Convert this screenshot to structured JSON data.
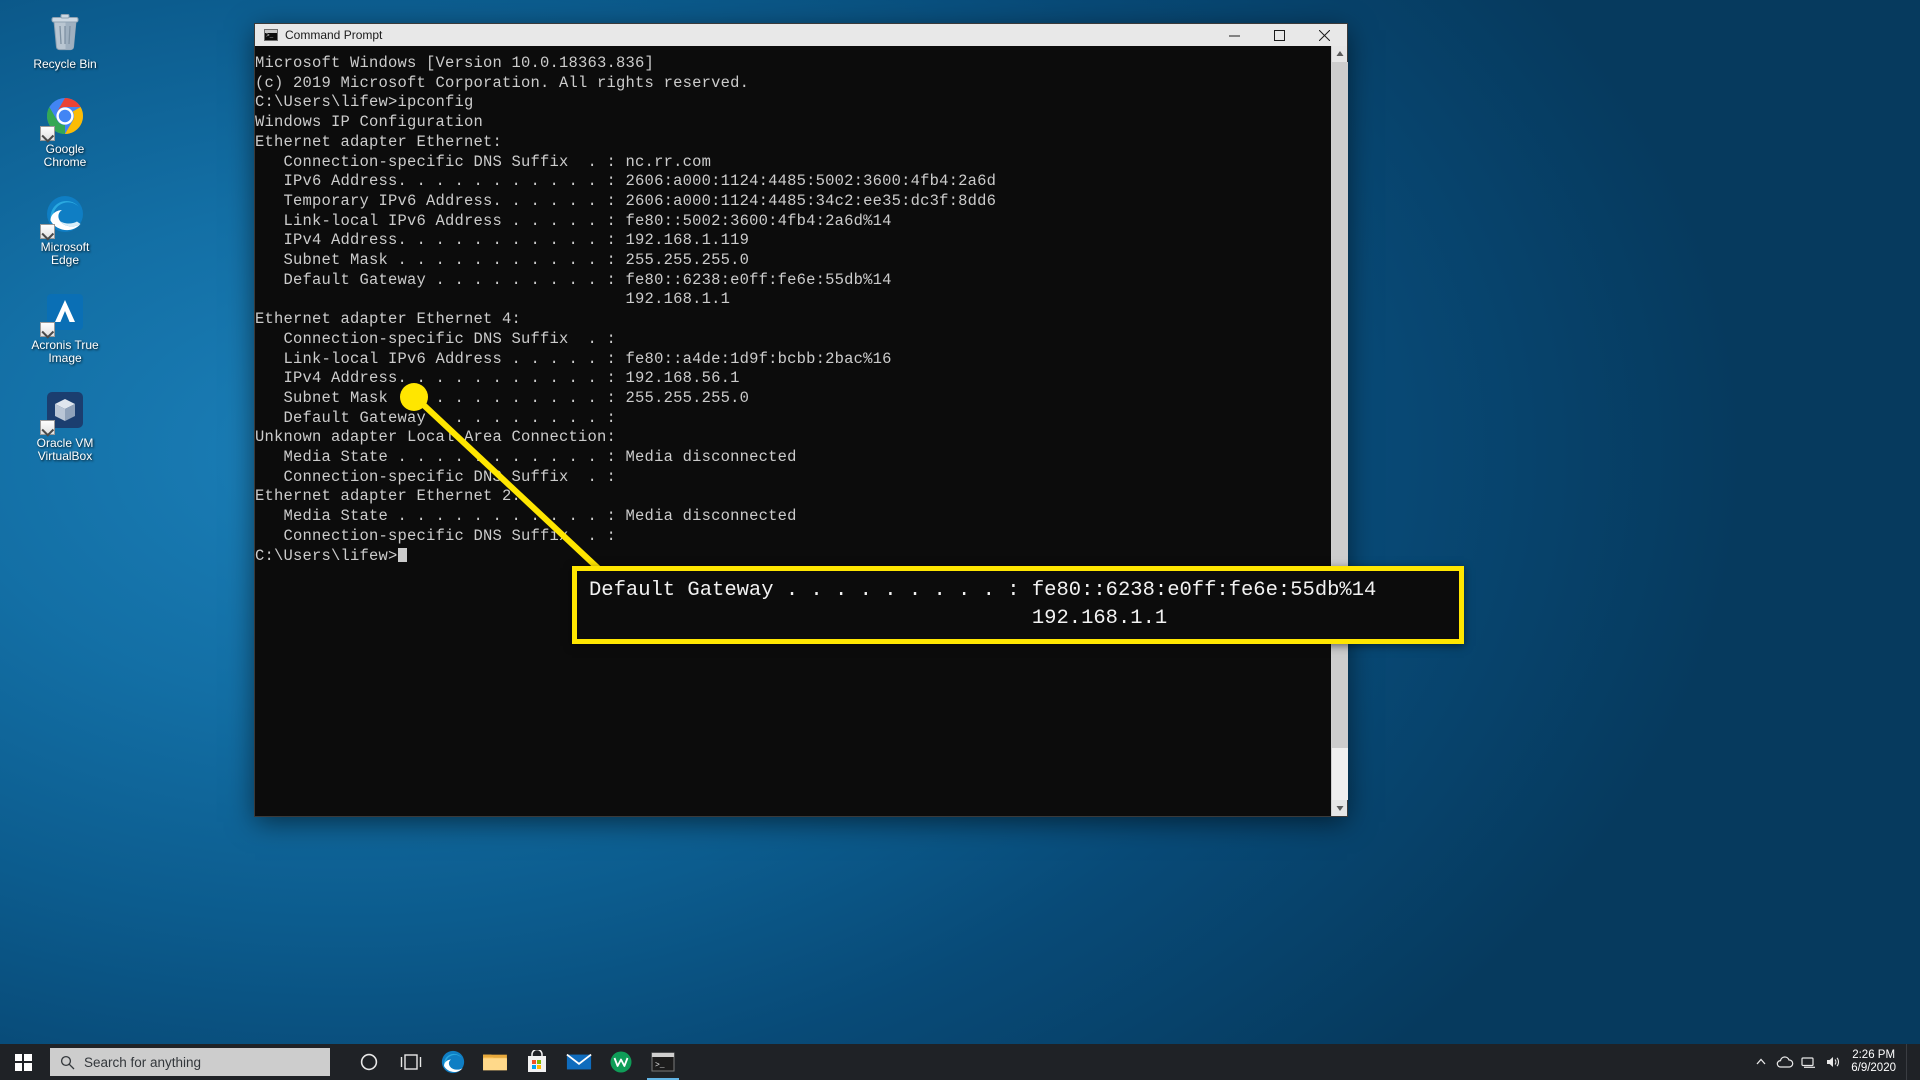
{
  "desktop": {
    "icons": [
      {
        "name": "recycle-bin",
        "label": "Recycle Bin"
      },
      {
        "name": "google-chrome",
        "label": "Google\nChrome"
      },
      {
        "name": "microsoft-edge",
        "label": "Microsoft\nEdge"
      },
      {
        "name": "acronis-true-image",
        "label": "Acronis True\nImage"
      },
      {
        "name": "oracle-vm-virtualbox",
        "label": "Oracle VM\nVirtualBox"
      }
    ]
  },
  "window": {
    "title": "Command Prompt",
    "icon": "command-prompt-icon",
    "buttons": {
      "minimize": "—",
      "maximize": "□",
      "close": "✕"
    }
  },
  "console": {
    "lines": [
      "Microsoft Windows [Version 10.0.18363.836]",
      "(c) 2019 Microsoft Corporation. All rights reserved.",
      "",
      "C:\\Users\\lifew>ipconfig",
      "",
      "Windows IP Configuration",
      "",
      "",
      "Ethernet adapter Ethernet:",
      "",
      "   Connection-specific DNS Suffix  . : nc.rr.com",
      "   IPv6 Address. . . . . . . . . . . : 2606:a000:1124:4485:5002:3600:4fb4:2a6d",
      "   Temporary IPv6 Address. . . . . . : 2606:a000:1124:4485:34c2:ee35:dc3f:8dd6",
      "   Link-local IPv6 Address . . . . . : fe80::5002:3600:4fb4:2a6d%14",
      "   IPv4 Address. . . . . . . . . . . : 192.168.1.119",
      "   Subnet Mask . . . . . . . . . . . : 255.255.255.0",
      "   Default Gateway . . . . . . . . . : fe80::6238:e0ff:fe6e:55db%14",
      "                                       192.168.1.1",
      "",
      "Ethernet adapter Ethernet 4:",
      "",
      "   Connection-specific DNS Suffix  . :",
      "   Link-local IPv6 Address . . . . . : fe80::a4de:1d9f:bcbb:2bac%16",
      "   IPv4 Address. . . . . . . . . . . : 192.168.56.1",
      "   Subnet Mask . . . . . . . . . . . : 255.255.255.0",
      "   Default Gateway . . . . . . . . . :",
      "",
      "Unknown adapter Local Area Connection:",
      "",
      "   Media State . . . . . . . . . . . : Media disconnected",
      "   Connection-specific DNS Suffix  . :",
      "",
      "Ethernet adapter Ethernet 2:",
      "",
      "   Media State . . . . . . . . . . . : Media disconnected",
      "   Connection-specific DNS Suffix  . :",
      "",
      "C:\\Users\\lifew>"
    ]
  },
  "callout": {
    "line1": "Default Gateway . . . . . . . . . : fe80::6238:e0ff:fe6e:55db%14",
    "line2": "                                    192.168.1.1",
    "color": "#ffe600"
  },
  "taskbar": {
    "start": "start-button",
    "search": {
      "placeholder": "Search for anything",
      "value": "Search for anything"
    },
    "icons": [
      {
        "name": "cortana",
        "label": "Cortana"
      },
      {
        "name": "task-view",
        "label": "Task View"
      },
      {
        "name": "microsoft-edge",
        "label": "Microsoft Edge"
      },
      {
        "name": "file-explorer",
        "label": "File Explorer"
      },
      {
        "name": "microsoft-store",
        "label": "Microsoft Store"
      },
      {
        "name": "mail",
        "label": "Mail"
      },
      {
        "name": "wondershare",
        "label": "Wondershare"
      },
      {
        "name": "command-prompt",
        "label": "Command Prompt"
      }
    ],
    "tray": [
      {
        "name": "show-hidden-icons",
        "glyph": "∧"
      },
      {
        "name": "onedrive",
        "glyph": "☁"
      },
      {
        "name": "network",
        "glyph": "▭"
      },
      {
        "name": "volume",
        "glyph": "◁"
      }
    ],
    "clock": {
      "time": "2:26 PM",
      "date": "6/9/2020"
    }
  }
}
